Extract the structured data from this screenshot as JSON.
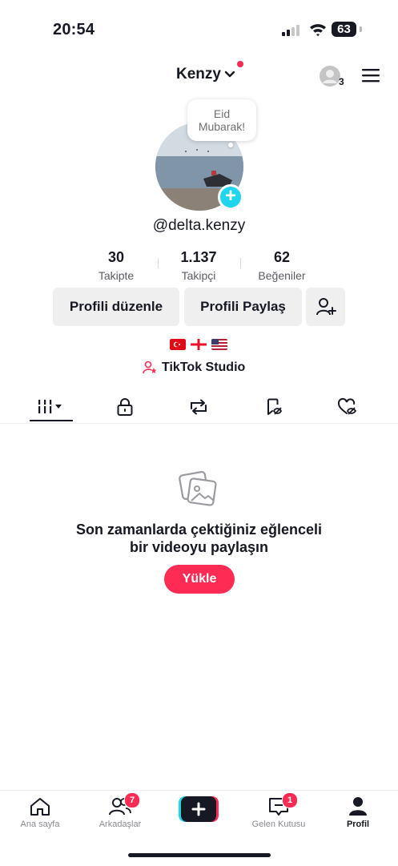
{
  "status_bar": {
    "time": "20:54",
    "battery": "63"
  },
  "header": {
    "username": "Kenzy",
    "visitor_count": "3"
  },
  "profile": {
    "bubble_line1": "Eid",
    "bubble_line2": "Mubarak!",
    "handle": "@delta.kenzy",
    "stats": [
      {
        "value": "30",
        "label": "Takipte"
      },
      {
        "value": "1.137",
        "label": "Takipçi"
      },
      {
        "value": "62",
        "label": "Beğeniler"
      }
    ],
    "edit_button": "Profili düzenle",
    "share_button": "Profili Paylaş",
    "studio_label": "TikTok Studio",
    "flags": [
      "turkey-flag",
      "georgia-flag",
      "usa-flag"
    ]
  },
  "tabs": [
    "videos-grid-icon",
    "lock-icon",
    "repost-icon",
    "favorites-icon",
    "liked-icon"
  ],
  "empty_state": {
    "line1": "Son zamanlarda çektiğiniz eğlenceli",
    "line2": "bir videoyu paylaşın",
    "upload_label": "Yükle"
  },
  "nav": {
    "home": "Ana sayfa",
    "friends": "Arkadaşlar",
    "friends_badge": "7",
    "inbox": "Gelen Kutusu",
    "inbox_badge": "1",
    "profile": "Profil"
  },
  "colors": {
    "accent": "#fe2c55",
    "cyan": "#20d5ec",
    "text": "#161823",
    "button_bg": "#efeff0"
  }
}
